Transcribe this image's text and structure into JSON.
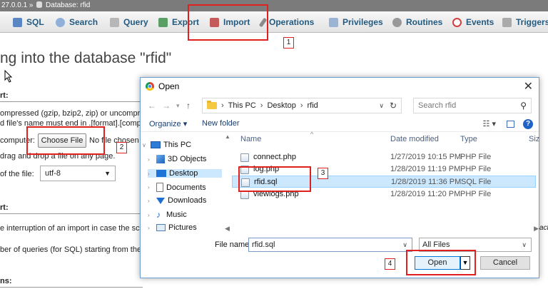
{
  "breadcrumb": {
    "server": "27.0.0.1 »",
    "database": "Database: rfid"
  },
  "tabs": [
    {
      "label": "SQL",
      "icon": "sql-icon"
    },
    {
      "label": "Search",
      "icon": "search-icon"
    },
    {
      "label": "Query",
      "icon": "query-icon"
    },
    {
      "label": "Export",
      "icon": "export-icon"
    },
    {
      "label": "Import",
      "icon": "import-icon"
    },
    {
      "label": "Operations",
      "icon": "wrench-icon"
    },
    {
      "label": "Privileges",
      "icon": "privileges-icon"
    },
    {
      "label": "Routines",
      "icon": "routines-icon"
    },
    {
      "label": "Events",
      "icon": "clock-icon"
    },
    {
      "label": "Triggers",
      "icon": "triggers-icon"
    }
  ],
  "page": {
    "heading": "ng into the database \"rfid\"",
    "file_section_label": "rt:",
    "compress_line1": "ompressed (gzip, bzip2, zip) or uncompre",
    "compress_line2": "d file's name must end in .[format].[comp",
    "computer_label": "computer:",
    "choose_file": "Choose File",
    "no_file": "No file chosen",
    "drag_drop": "drag and drop a file on any page.",
    "charset_label": "of the file:",
    "charset_value": "utf-8",
    "partial_section_label": "rt:",
    "interrupt_text": "e interruption of an import in case the scrip",
    "queries_text": "ber of queries (for SQL) starting from the f",
    "options_section_label": "ns:"
  },
  "dialog": {
    "title": "Open",
    "close": "✕",
    "path": [
      "This PC",
      "Desktop",
      "rfid"
    ],
    "search_placeholder": "Search rfid",
    "organize": "Organize ▾",
    "new_folder": "New folder",
    "nav_tree": [
      {
        "label": "This PC",
        "icon": "computer-icon"
      },
      {
        "label": "3D Objects",
        "icon": "3d-objects-icon"
      },
      {
        "label": "Desktop",
        "icon": "desktop-icon"
      },
      {
        "label": "Documents",
        "icon": "documents-icon"
      },
      {
        "label": "Downloads",
        "icon": "downloads-icon"
      },
      {
        "label": "Music",
        "icon": "music-icon"
      },
      {
        "label": "Pictures",
        "icon": "pictures-icon"
      }
    ],
    "columns": {
      "name": "Name",
      "date": "Date modified",
      "type": "Type",
      "size": "Siz"
    },
    "files": [
      {
        "name": "connect.php",
        "date": "1/27/2019 10:15 PM",
        "type": "PHP File"
      },
      {
        "name": "log.php",
        "date": "1/28/2019 11:19 PM",
        "type": "PHP File"
      },
      {
        "name": "rfid.sql",
        "date": "1/28/2019 11:36 PM",
        "type": "SQL File"
      },
      {
        "name": "viewlogs.php",
        "date": "1/28/2019 11:20 PM",
        "type": "PHP File"
      }
    ],
    "filename_label": "File name:",
    "filename_value": "rfid.sql",
    "filetype_value": "All Files",
    "open_button": "Open",
    "cancel_button": "Cancel"
  },
  "annotations": [
    "1",
    "2",
    "3",
    "4"
  ],
  "right_edge_text": "acti"
}
